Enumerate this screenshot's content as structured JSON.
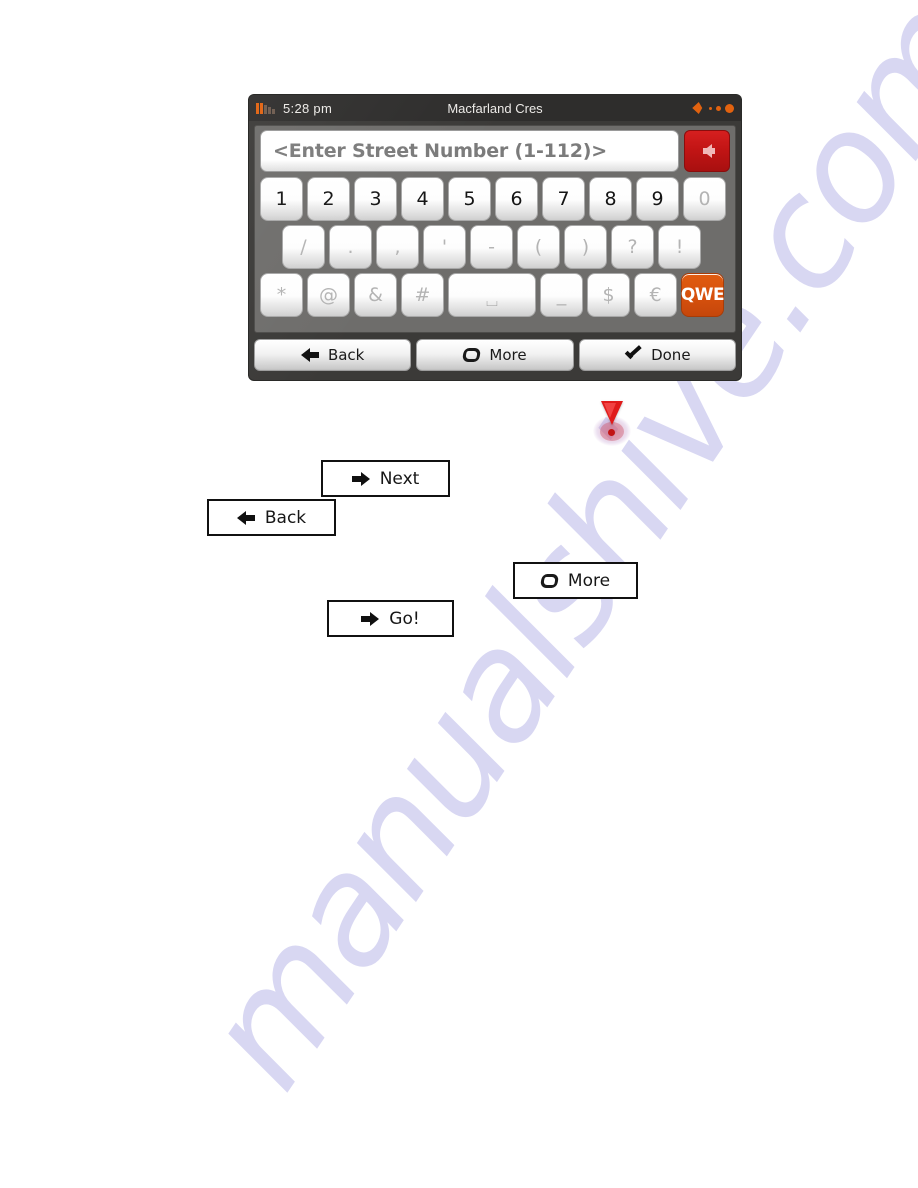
{
  "watermark": {
    "text": "manualshive.com"
  },
  "device": {
    "status_bar": {
      "time": "5:28 pm",
      "title": "Macfarland Cres",
      "signal_icon": "signal-bars-icon",
      "gps_icon": "gps-satellite-icon"
    },
    "input": {
      "value": "<Enter Street Number (1-112)>",
      "placeholder": "<Enter Street Number (1-112)>",
      "backspace_icon": "backspace-arrow-icon"
    },
    "keyboard": {
      "row1": [
        {
          "label": "1",
          "disabled": false
        },
        {
          "label": "2",
          "disabled": false
        },
        {
          "label": "3",
          "disabled": false
        },
        {
          "label": "4",
          "disabled": false
        },
        {
          "label": "5",
          "disabled": false
        },
        {
          "label": "6",
          "disabled": false
        },
        {
          "label": "7",
          "disabled": false
        },
        {
          "label": "8",
          "disabled": false
        },
        {
          "label": "9",
          "disabled": false
        },
        {
          "label": "0",
          "disabled": true
        }
      ],
      "row2": [
        {
          "label": "/",
          "disabled": true
        },
        {
          "label": ".",
          "disabled": true
        },
        {
          "label": ",",
          "disabled": true
        },
        {
          "label": "'",
          "disabled": true
        },
        {
          "label": "-",
          "disabled": true
        },
        {
          "label": "(",
          "disabled": true
        },
        {
          "label": ")",
          "disabled": true
        },
        {
          "label": "?",
          "disabled": true
        },
        {
          "label": "!",
          "disabled": true
        }
      ],
      "row3": [
        {
          "label": "*",
          "disabled": true
        },
        {
          "label": "@",
          "disabled": true
        },
        {
          "label": "&",
          "disabled": true
        },
        {
          "label": "#",
          "disabled": true
        },
        {
          "label": "⌴",
          "disabled": true
        },
        {
          "label": "_",
          "disabled": true
        },
        {
          "label": "$",
          "disabled": true
        },
        {
          "label": "€",
          "disabled": true
        },
        {
          "label": "QWE",
          "disabled": false
        }
      ]
    },
    "bottom_bar": {
      "back": "Back",
      "more": "More",
      "done": "Done"
    }
  },
  "callouts": {
    "next": "Next",
    "back": "Back",
    "more": "More",
    "go": "Go!"
  },
  "pin": {
    "icon": "warning-pin-icon"
  },
  "colors": {
    "accent_orange": "#e2620f",
    "qwe_orange": "#d6500d",
    "backspace_red": "#c01414",
    "pin_red": "#e01b1b",
    "bezel": "#3b3a38",
    "keyboard_panel": "#6e6d6b",
    "watermark_purple": "#b9b7e8"
  }
}
